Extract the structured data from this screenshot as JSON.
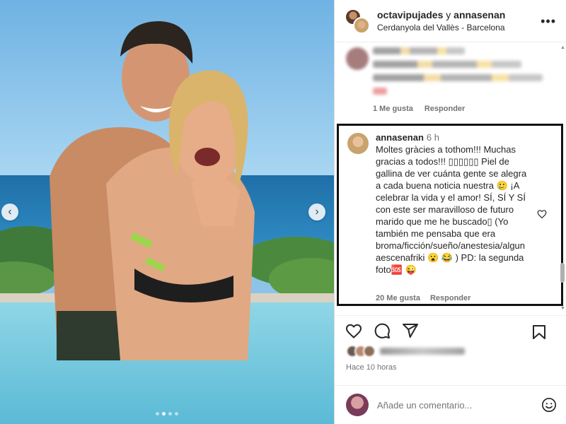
{
  "post": {
    "owner_a": "octavipujades",
    "and_text": "y",
    "owner_b": "annasenan",
    "location": "Cerdanyola del Vallès - Barcelona",
    "more_icon": "more-horizontal-icon"
  },
  "carousel": {
    "prev_icon": "‹",
    "next_icon": "›",
    "dot_count": 4,
    "active_dot": 1
  },
  "comments": {
    "first": {
      "likes": "1 Me gusta",
      "reply": "Responder"
    },
    "highlighted": {
      "user": "annasenan",
      "time": "6 h",
      "text": "Moltes gràcies a tothom!!! Muchas gracias a todos!!! ▯▯▯▯▯▯ Piel de gallina de ver cuánta gente se alegra a cada buena noticia nuestra 🥲 ¡A celebrar la vida y el amor! SÍ, SÍ Y SÍ con este ser maravilloso de futuro marido que me he buscado▯ (Yo también me pensaba que era broma/ficción/sueño/anestesia/algunaescenafriki 😮 😂 ) PD: la segunda foto🆘 😜",
      "likes": "20 Me gusta",
      "reply": "Responder"
    }
  },
  "footer": {
    "posted": "Hace 10 horas",
    "comment_placeholder": "Añade un comentario..."
  }
}
